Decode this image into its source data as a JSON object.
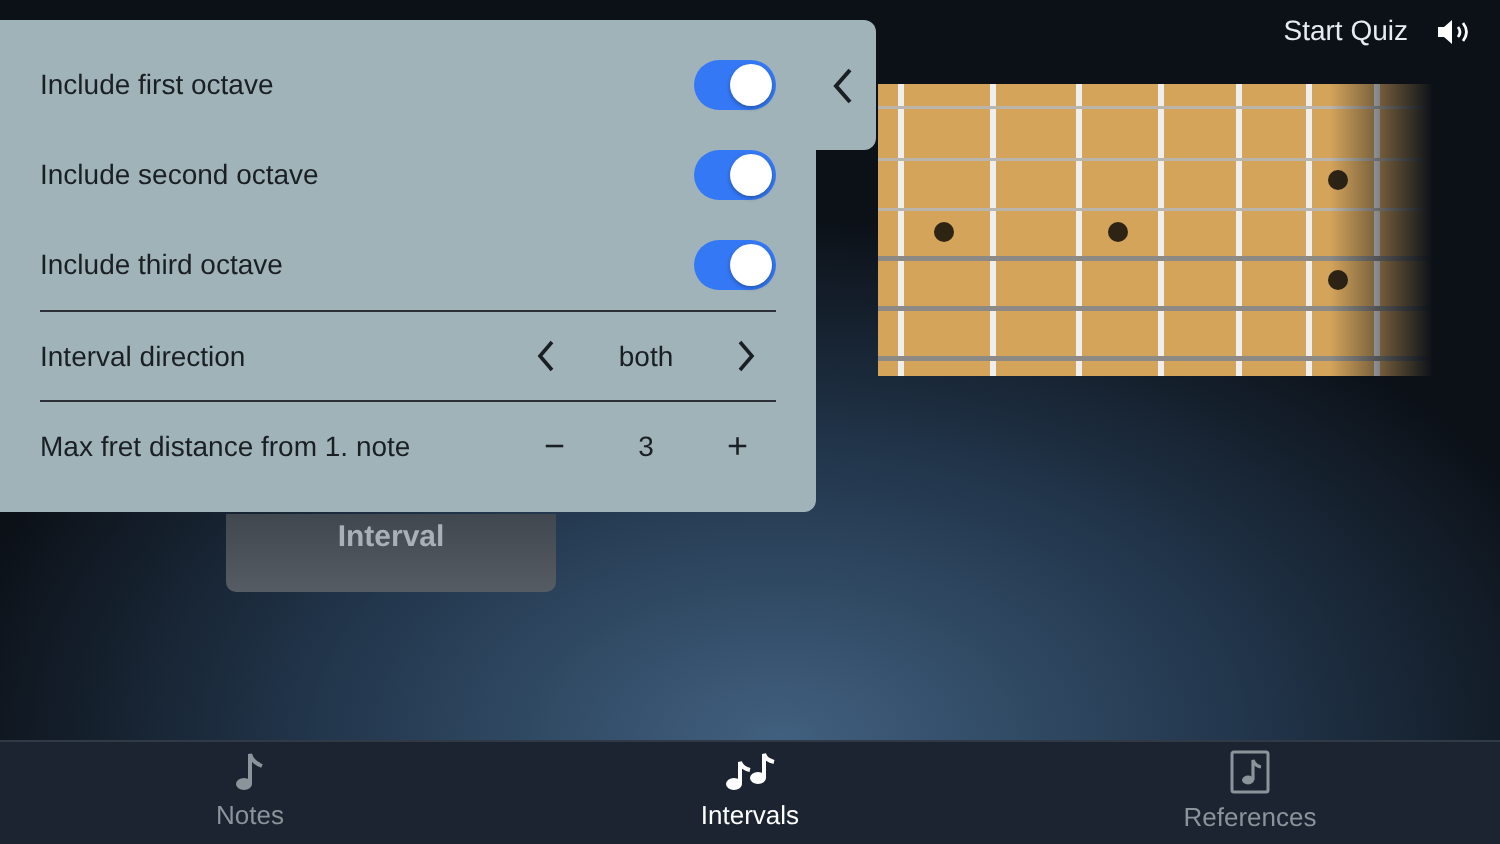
{
  "header": {
    "action": "Start Quiz"
  },
  "interval_button": {
    "label": "Interval"
  },
  "settings": {
    "toggles": [
      {
        "label": "Include first octave",
        "on": true
      },
      {
        "label": "Include second octave",
        "on": true
      },
      {
        "label": "Include third octave",
        "on": true
      }
    ],
    "direction": {
      "label": "Interval direction",
      "value": "both"
    },
    "max_fret": {
      "label": "Max fret distance from 1. note",
      "minus": "−",
      "value": "3",
      "plus": "+"
    }
  },
  "tabs": [
    {
      "label": "Notes",
      "kind": "note",
      "selected": false
    },
    {
      "label": "Intervals",
      "kind": "notes",
      "selected": true
    },
    {
      "label": "References",
      "kind": "book",
      "selected": false
    }
  ]
}
